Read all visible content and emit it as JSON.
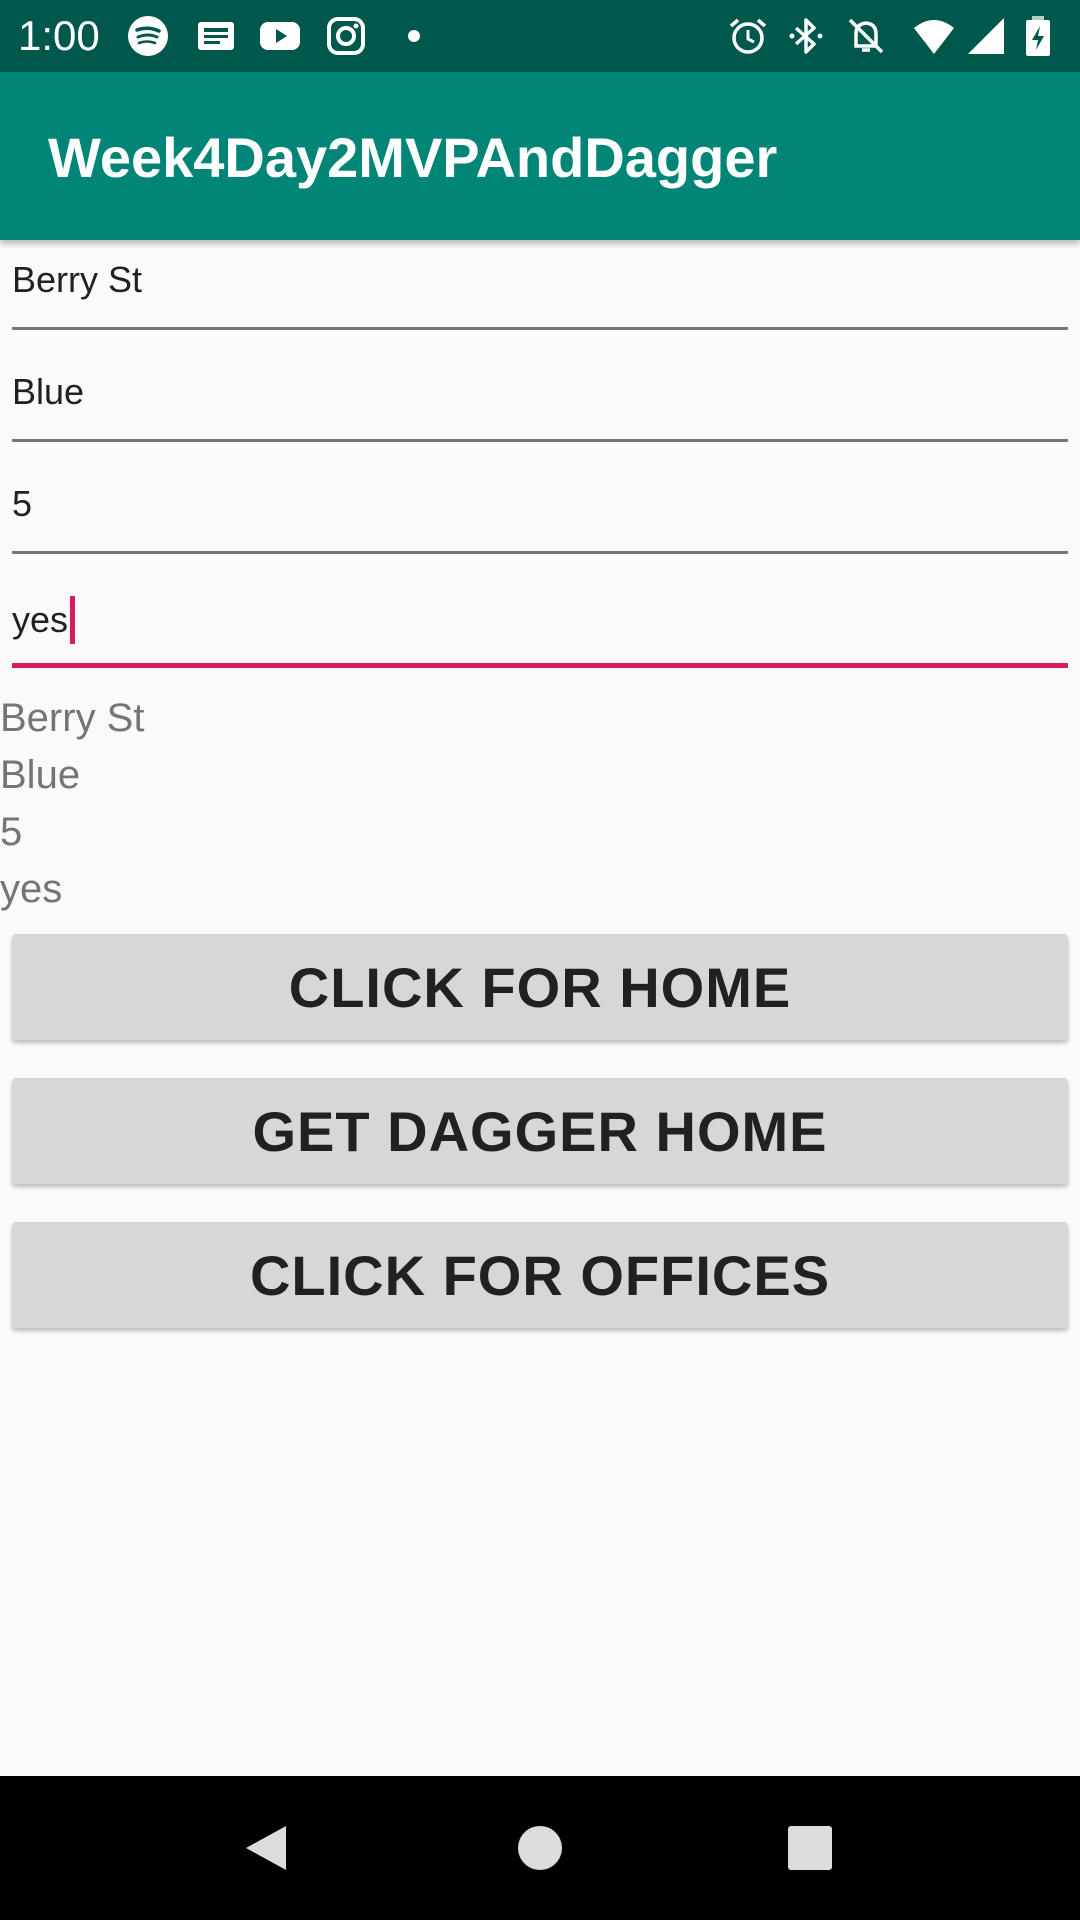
{
  "status_bar": {
    "time": "1:00",
    "left_icons": [
      "spotify-icon",
      "news-icon",
      "youtube-icon",
      "instagram-icon",
      "dot-icon"
    ],
    "right_icons": [
      "alarm-icon",
      "bluetooth-icon",
      "notifications-off-icon",
      "wifi-icon",
      "signal-icon",
      "battery-charging-icon"
    ],
    "color": "#00574b"
  },
  "app_bar": {
    "title": "Week4Day2MVPAndDagger",
    "color": "#008577"
  },
  "fields": [
    {
      "value": "Berry St"
    },
    {
      "value": "Blue"
    },
    {
      "value": "5"
    },
    {
      "value": "yes",
      "focused": true
    }
  ],
  "output": {
    "lines": [
      "Berry St",
      "Blue",
      "5",
      "yes"
    ]
  },
  "buttons": {
    "home": "CLICK FOR HOME",
    "dagger_home": "GET DAGGER HOME",
    "offices": "CLICK FOR OFFICES"
  },
  "nav_bar": {
    "icons": [
      "back-icon",
      "home-icon",
      "recents-icon"
    ]
  },
  "colors": {
    "accent": "#d81b60",
    "button_bg": "#d6d7d7",
    "background": "#fafafa"
  }
}
